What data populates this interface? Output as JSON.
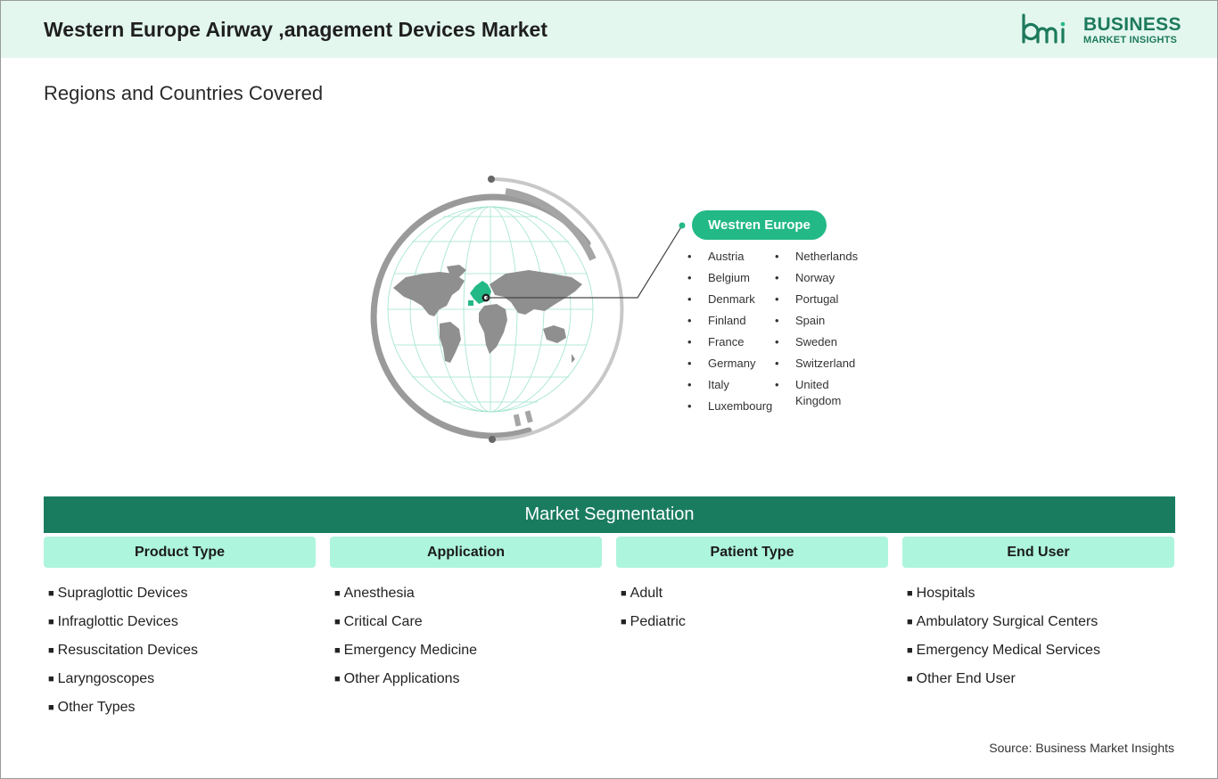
{
  "header": {
    "title": "Western Europe Airway ,anagement Devices Market",
    "logo_line1": "BUSINESS",
    "logo_line2": "MARKET INSIGHTS",
    "logo_mark": "bmi",
    "brand_color": "#1d7a5c"
  },
  "regions": {
    "section_title": "Regions and Countries Covered",
    "region_label": "Westren Europe",
    "countries_col1": [
      "Austria",
      "Belgium",
      "Denmark",
      "Finland",
      "France",
      "Germany",
      "Italy",
      "Luxembourg"
    ],
    "countries_col2": [
      "Netherlands",
      "Norway",
      "Portugal",
      "Spain",
      "Sweden",
      "Switzerland",
      "United Kingdom"
    ],
    "accent": "#23b987",
    "globe_icon": "world-map-globe-icon"
  },
  "segmentation": {
    "title": "Market Segmentation",
    "bar_color": "#1a7c5f",
    "header_color": "#adf5dc",
    "columns": [
      {
        "title": "Product Type",
        "items": [
          "Supraglottic Devices",
          "Infraglottic Devices",
          "Resuscitation Devices",
          "Laryngoscopes",
          "Other Types"
        ]
      },
      {
        "title": "Application",
        "items": [
          "Anesthesia",
          "Critical Care",
          "Emergency Medicine",
          "Other Applications"
        ]
      },
      {
        "title": "Patient Type",
        "items": [
          "Adult",
          "Pediatric"
        ]
      },
      {
        "title": "End User",
        "items": [
          "Hospitals",
          "Ambulatory Surgical Centers",
          "Emergency Medical Services",
          "Other End User"
        ]
      }
    ]
  },
  "footer": {
    "source": "Source: Business Market Insights"
  }
}
